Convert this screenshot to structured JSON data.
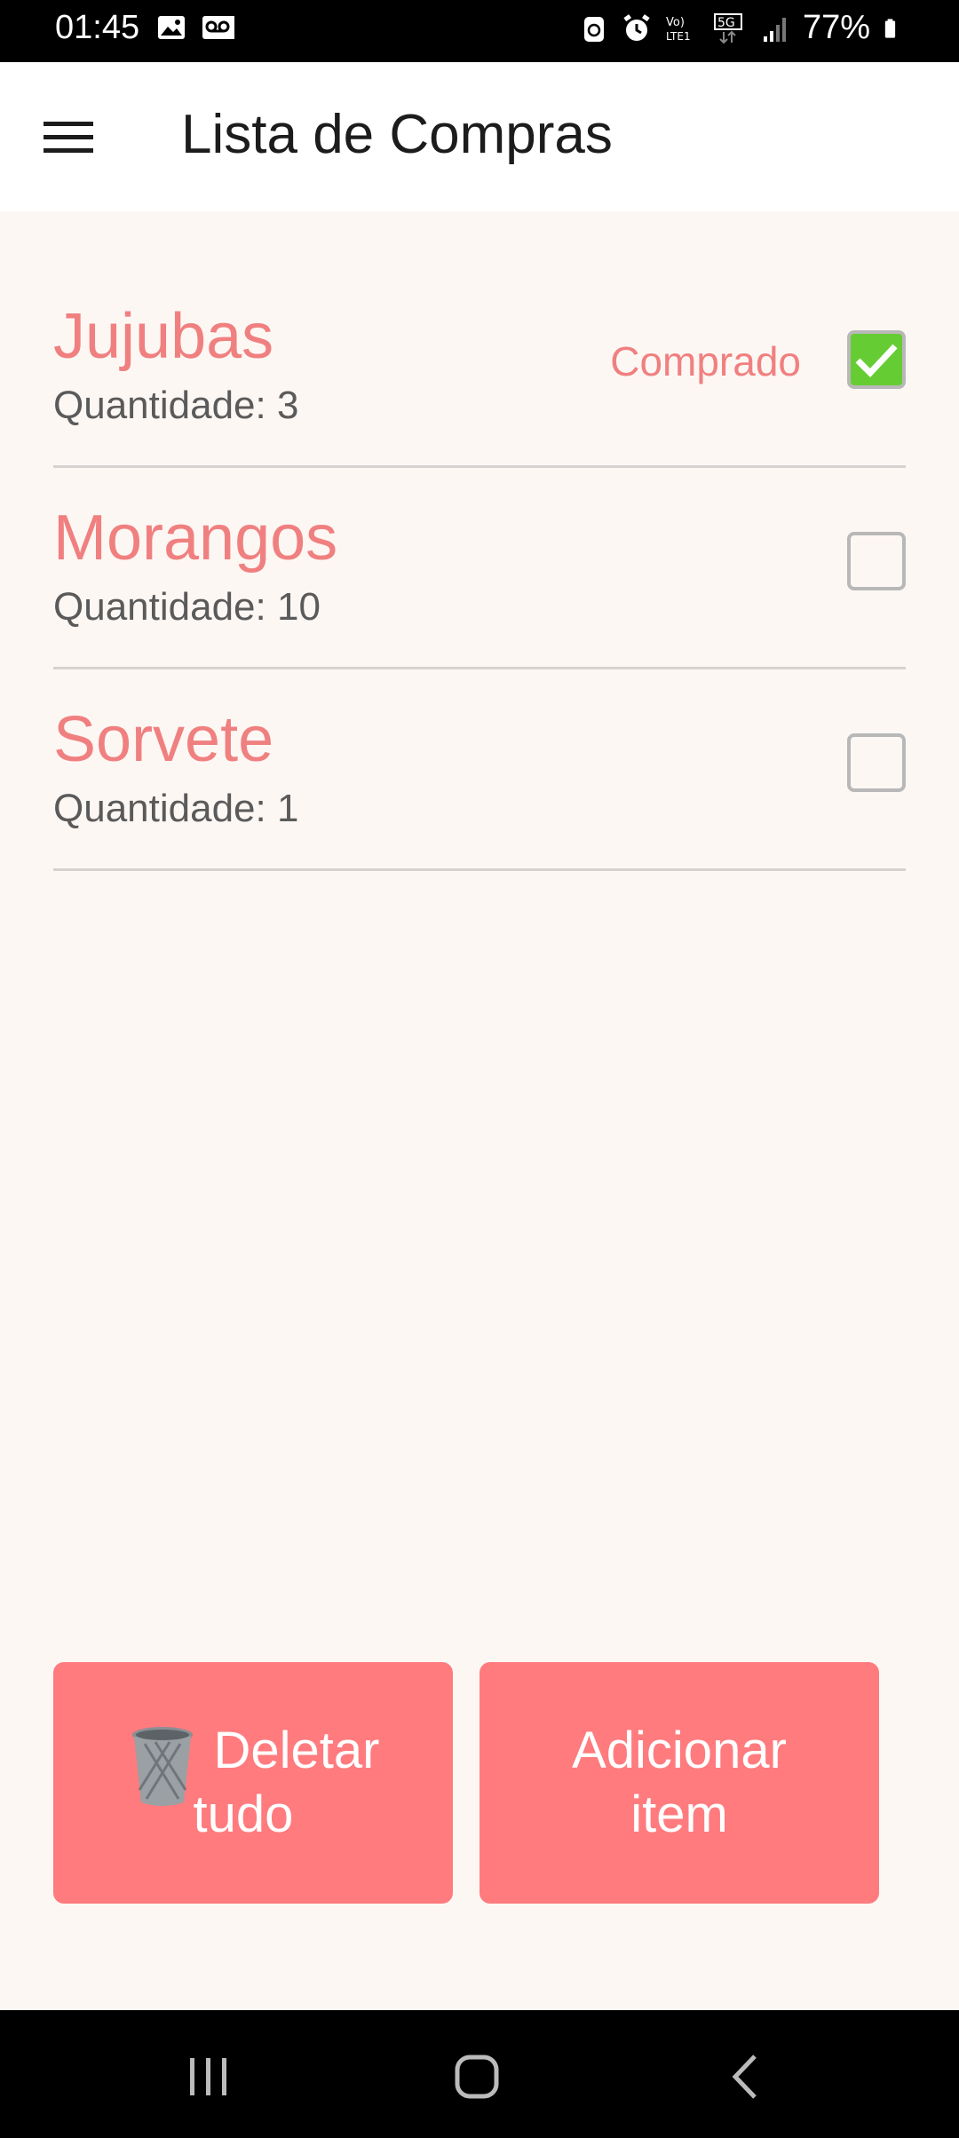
{
  "status_bar": {
    "time": "01:45",
    "battery": "77%",
    "icons": [
      "image-icon",
      "voicemail-icon",
      "recycle-icon",
      "alarm-icon",
      "volte-icon",
      "5g-icon",
      "signal-icon",
      "battery-icon"
    ]
  },
  "app_bar": {
    "title": "Lista de Compras",
    "menu_icon": "menu-icon"
  },
  "items": [
    {
      "name": "Jujubas",
      "quantity": "Quantidade: 3",
      "status": "Comprado",
      "checked": true
    },
    {
      "name": "Morangos",
      "quantity": "Quantidade: 10",
      "status": "",
      "checked": false
    },
    {
      "name": "Sorvete",
      "quantity": "Quantidade: 1",
      "status": "",
      "checked": false
    }
  ],
  "buttons": {
    "delete_all": {
      "line1": "Deletar",
      "line2": "tudo",
      "icon": "trash-icon"
    },
    "add_item": {
      "line1": "Adicionar",
      "line2": "item"
    }
  },
  "colors": {
    "accent": "#ff7b7e",
    "item_text": "#f08080",
    "check_green": "#66cc33",
    "background": "#fdf7f4"
  },
  "nav_bar": {
    "icons": [
      "recent-apps-icon",
      "home-icon",
      "back-icon"
    ]
  }
}
